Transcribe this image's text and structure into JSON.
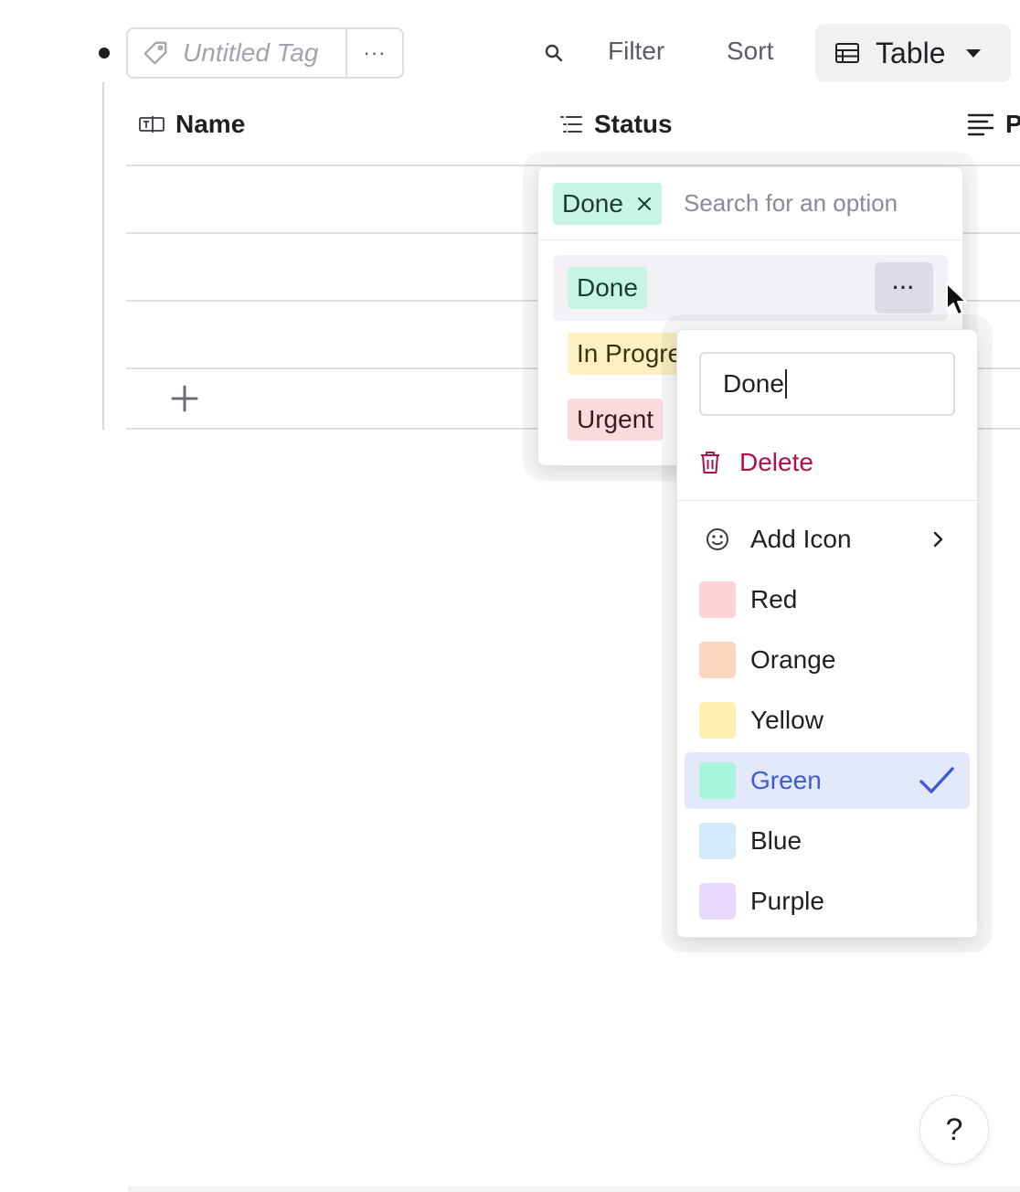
{
  "toolbar": {
    "tag_placeholder": "Untitled Tag",
    "more_label": "···",
    "filter_label": "Filter",
    "sort_label": "Sort",
    "view_label": "Table"
  },
  "table": {
    "columns": [
      {
        "label": "Name",
        "icon": "text-field-icon"
      },
      {
        "label": "Status",
        "icon": "list-icon"
      },
      {
        "label": "P",
        "icon": "paragraph-icon"
      }
    ]
  },
  "status_dropdown": {
    "selected_chip": "Done",
    "search_placeholder": "Search for an option",
    "options": [
      {
        "label": "Done",
        "color": "#c7f5e4"
      },
      {
        "label": "In Progress",
        "color": "#fdf1c4"
      },
      {
        "label": "Urgent",
        "color": "#fadadd"
      }
    ],
    "option_more_label": "···"
  },
  "option_menu": {
    "name_value": "Done",
    "delete_label": "Delete",
    "add_icon_label": "Add Icon",
    "colors": [
      {
        "label": "Red",
        "swatch": "#fcd2d5"
      },
      {
        "label": "Orange",
        "swatch": "#fdd5bf"
      },
      {
        "label": "Yellow",
        "swatch": "#fdf0b2"
      },
      {
        "label": "Green",
        "swatch": "#a9f5dc",
        "selected": true
      },
      {
        "label": "Blue",
        "swatch": "#d5ebfc"
      },
      {
        "label": "Purple",
        "swatch": "#ead9fc"
      }
    ]
  },
  "help_label": "?"
}
